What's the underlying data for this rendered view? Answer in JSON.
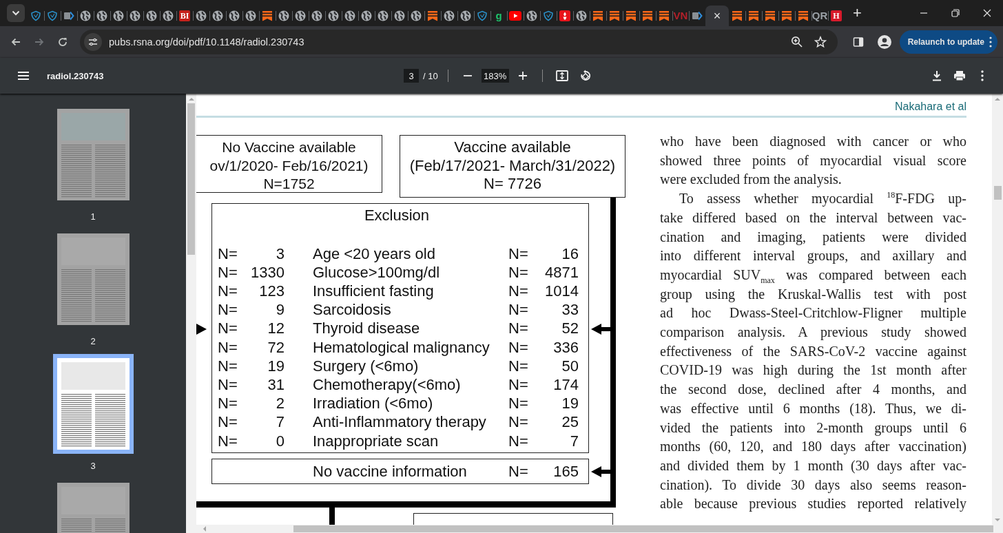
{
  "tabs": [
    {
      "kind": "shield",
      "selected": false
    },
    {
      "kind": "shield",
      "selected": false
    },
    {
      "kind": "chevron",
      "selected": false
    },
    {
      "kind": "globe",
      "selected": false
    },
    {
      "kind": "globe",
      "selected": false
    },
    {
      "kind": "globe",
      "selected": false
    },
    {
      "kind": "globe",
      "selected": false
    },
    {
      "kind": "globe",
      "selected": false
    },
    {
      "kind": "globe",
      "selected": false
    },
    {
      "kind": "letter",
      "glyph": "BI",
      "color": "#c4201a",
      "selected": false
    },
    {
      "kind": "globe",
      "selected": false
    },
    {
      "kind": "globe",
      "selected": false
    },
    {
      "kind": "globe",
      "selected": false
    },
    {
      "kind": "globe",
      "selected": false
    },
    {
      "kind": "bookmark",
      "selected": false
    },
    {
      "kind": "globe",
      "selected": false
    },
    {
      "kind": "globe",
      "selected": false
    },
    {
      "kind": "globe",
      "selected": false
    },
    {
      "kind": "globe",
      "selected": false
    },
    {
      "kind": "globe",
      "selected": false
    },
    {
      "kind": "globe",
      "selected": false
    },
    {
      "kind": "globe",
      "selected": false
    },
    {
      "kind": "globe",
      "selected": false
    },
    {
      "kind": "globe",
      "selected": false
    },
    {
      "kind": "bookmark",
      "selected": false
    },
    {
      "kind": "globe",
      "selected": false
    },
    {
      "kind": "globe",
      "selected": false
    },
    {
      "kind": "shield",
      "selected": false
    },
    {
      "kind": "glyph",
      "glyph": "g",
      "color": "#1ec26b",
      "selected": false
    },
    {
      "kind": "video",
      "selected": false
    },
    {
      "kind": "globe",
      "selected": false
    },
    {
      "kind": "shield",
      "selected": false
    },
    {
      "kind": "torch",
      "selected": false
    },
    {
      "kind": "globe",
      "selected": false
    },
    {
      "kind": "bookmark",
      "selected": false
    },
    {
      "kind": "bookmark",
      "selected": false
    },
    {
      "kind": "bookmark",
      "selected": false
    },
    {
      "kind": "bookmark",
      "selected": false
    },
    {
      "kind": "bookmark",
      "selected": false
    },
    {
      "kind": "glyph",
      "glyph": "VN",
      "color": "#b3202a",
      "selected": false
    },
    {
      "kind": "chevron",
      "selected": false
    },
    {
      "kind": "active",
      "close": "×",
      "selected": true
    },
    {
      "kind": "bookmark",
      "selected": false
    },
    {
      "kind": "bookmark",
      "selected": false
    },
    {
      "kind": "bookmark",
      "selected": false
    },
    {
      "kind": "bookmark",
      "selected": false
    },
    {
      "kind": "bookmark",
      "selected": false
    },
    {
      "kind": "glyph",
      "glyph": "QR",
      "color": "#9aa0a6",
      "selected": false
    },
    {
      "kind": "letter",
      "glyph": "H",
      "color": "#d7192a",
      "selected": false
    }
  ],
  "new_tab": "+",
  "nav": [
    {
      "kind": "back",
      "disabled": false
    },
    {
      "kind": "forward",
      "disabled": true
    },
    {
      "kind": "reload",
      "disabled": false
    }
  ],
  "address": {
    "url": "pubs.rsna.org/doi/pdf/10.1148/radiol.230743"
  },
  "relaunch_button": "Relaunch to update",
  "pdf_toolbar": {
    "title": "radiol.230743",
    "page": "3",
    "page_total": "/ 10",
    "zoom": "183%"
  },
  "thumbnails": [
    {
      "label": "1",
      "selected": false
    },
    {
      "label": "2",
      "selected": false
    },
    {
      "label": "3",
      "selected": true
    },
    {
      "selected": false
    }
  ],
  "page": {
    "running_head": "Nakahara et al",
    "figure": {
      "left_box": [
        "No Vaccine available",
        "ov/1/2020- Feb/16/2021)",
        "N=1752"
      ],
      "right_box": [
        "Vaccine available",
        "(Feb/17/2021- March/31/2022)",
        "N= 7726"
      ],
      "exclusion": {
        "title": "Exclusion",
        "rows": [
          {
            "left_n": "N=",
            "left_count": "3",
            "reason": "Age <20 years old",
            "right_n": "N=",
            "right_count": "16"
          },
          {
            "left_n": "N=",
            "left_count": "1330",
            "reason": "Glucose>100mg/dl",
            "right_n": "N=",
            "right_count": "4871"
          },
          {
            "left_n": "N=",
            "left_count": "123",
            "reason": "Insufficient fasting",
            "right_n": "N=",
            "right_count": "1014"
          },
          {
            "left_n": "N=",
            "left_count": "9",
            "reason": "Sarcoidosis",
            "right_n": "N=",
            "right_count": "33"
          },
          {
            "left_n": "N=",
            "left_count": "12",
            "reason": "Thyroid disease",
            "right_n": "N=",
            "right_count": "52"
          },
          {
            "left_n": "N=",
            "left_count": "72",
            "reason": "Hematological malignancy",
            "right_n": "N=",
            "right_count": "336"
          },
          {
            "left_n": "N=",
            "left_count": "19",
            "reason": "Surgery (<6mo)",
            "right_n": "N=",
            "right_count": "50"
          },
          {
            "left_n": "N=",
            "left_count": "31",
            "reason": "Chemotherapy(<6mo)",
            "right_n": "N=",
            "right_count": "174"
          },
          {
            "left_n": "N=",
            "left_count": "2",
            "reason": "Irradiation (<6mo)",
            "right_n": "N=",
            "right_count": "19"
          },
          {
            "left_n": "N=",
            "left_count": "7",
            "reason": "Anti-Inflammatory therapy",
            "right_n": "N=",
            "right_count": "25"
          },
          {
            "left_n": "N=",
            "left_count": "0",
            "reason": "Inappropriate scan",
            "right_n": "N=",
            "right_count": "7"
          }
        ]
      },
      "no_vaccine": {
        "reason": "No vaccine information",
        "right_n": "N=",
        "right_count": "165"
      }
    },
    "paragraphs": [
      {
        "indent": false,
        "lines": [
          "who have been diagnosed with cancer or who",
          "showed three points of myocardial visual score",
          "were excluded from the analysis."
        ],
        "continues": false
      },
      {
        "indent": true,
        "lines": [
          "To assess whether myocardial $^{18}$F-FDG up-",
          "take differed based on the interval between vac-",
          "cination and imaging, patients were divided",
          "into different interval groups, and axillary and",
          "myocardial SUV$_{max}$ was compared between each",
          "group using the Kruskal-Wallis test with post",
          "ad hoc Dwass-Steel-Critchlow-Fligner multiple",
          "comparison analysis. A previous study showed",
          "effectiveness of the SARS-CoV-2 vaccine against",
          "COVID-19 was high during the 1st month after",
          "the second dose, declined after 4 months, and",
          "was effective until 6 months (18). Thus, we di-",
          "vided the patients into 2-month groups until 6",
          "months (60, 120, and 180 days after vaccination)",
          "and divided them by 1 month (30 days after vac-",
          "cination). To divide 30 days also seems reason-",
          "able because previous studies reported relatively"
        ],
        "continues": true
      }
    ]
  }
}
